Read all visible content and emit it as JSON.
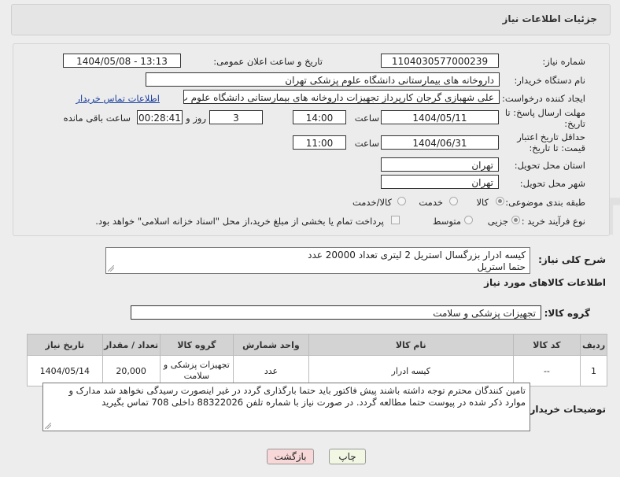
{
  "header": {
    "title": "جزئیات اطلاعات نیاز"
  },
  "form": {
    "need_number_label": "شماره نیاز:",
    "need_number": "1104030577000239",
    "announce_label": "تاریخ و ساعت اعلان عمومی:",
    "announce_value": "1404/05/08 - 13:13",
    "buyer_org_label": "نام دستگاه خریدار:",
    "buyer_org": "داروخانه های بیمارستانی دانشگاه علوم پزشکی تهران",
    "creator_label": "ایجاد کننده درخواست:",
    "creator": "علی شهبازی گرجان کارپرداز تجهیزات داروخانه های بیمارستانی دانشگاه علوم پ",
    "contact_link": "اطلاعات تماس خریدار",
    "reply_deadline_label": "مهلت ارسال پاسخ: تا تاریخ:",
    "reply_date": "1404/05/11",
    "time_label": "ساعت",
    "reply_time": "14:00",
    "days_value": "3",
    "days_label": "روز و",
    "remaining_time": "00:28:41",
    "remaining_label": "ساعت باقی مانده",
    "validity_label": "حداقل تاریخ اعتبار قیمت: تا تاریخ:",
    "validity_date": "1404/06/31",
    "validity_time_label": "ساعت",
    "validity_time": "11:00",
    "province_label": "استان محل تحویل:",
    "province": "تهران",
    "city_label": "شهر محل تحویل:",
    "city": "تهران",
    "category_label": "طبقه بندی موضوعی:",
    "category_options": [
      "کالا",
      "خدمت",
      "کالا/خدمت"
    ],
    "process_label": "نوع فرآیند خرید :",
    "process_options": [
      "جزیی",
      "متوسط"
    ],
    "payment_note": "پرداخت تمام یا بخشی از مبلغ خرید،از محل \"اسناد خزانه اسلامی\" خواهد بود."
  },
  "description": {
    "label": "شرح کلی نیاز:",
    "text_line1": "کیسه ادرار بزرگسال استریل 2 لیتری تعداد 20000 عدد",
    "text_line2": "حتما استریل"
  },
  "goods": {
    "section_title": "اطلاعات کالاهای مورد نیاز",
    "group_label": "گروه کالا:",
    "group_value": "تجهیزات پزشکی و سلامت",
    "columns": [
      "ردیف",
      "کد کالا",
      "نام کالا",
      "واحد شمارش",
      "گروه کالا",
      "تعداد / مقدار",
      "تاریخ نیاز"
    ],
    "rows": [
      {
        "index": "1",
        "code": "--",
        "name": "کیسه ادرار",
        "unit": "عدد",
        "group": "تجهیزات پزشکی و سلامت",
        "qty": "20,000",
        "date": "1404/05/14"
      }
    ]
  },
  "buyer_notes": {
    "label": "توضیحات خریدار:",
    "text": "تامین کنندگان محترم توجه داشته باشند پیش فاکتور باید حتما بارگذاری گردد در غیر اینصورت رسیدگی نخواهد شد مدارک و موارد ذکر شده در پیوست حتما مطالعه گردد. در صورت نیاز با شماره تلفن 88322026 داخلی 708 تماس بگیرید"
  },
  "buttons": {
    "print": "چاپ",
    "back": "بازگشت"
  },
  "watermark": {
    "text": "AriaTender.neT"
  },
  "colors": {
    "link": "#1a3fa0",
    "back_button_bg": "#f7d7d7",
    "print_button_bg": "#f1f7e3"
  }
}
